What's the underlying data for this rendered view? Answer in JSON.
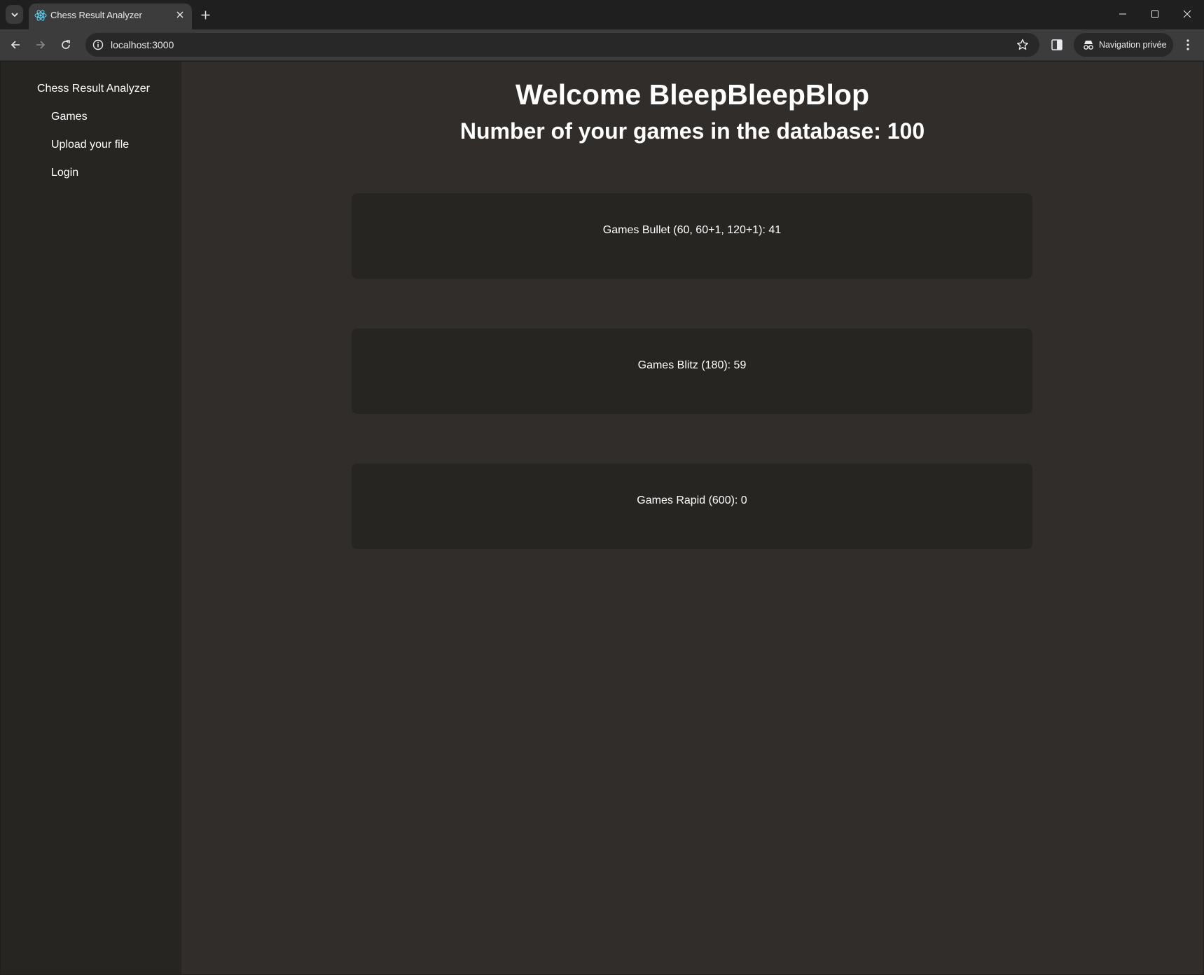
{
  "browser": {
    "tab_title": "Chess Result Analyzer",
    "url": "localhost:3000",
    "incognito_label": "Navigation privée"
  },
  "sidebar": {
    "brand": "Chess Result Analyzer",
    "items": [
      {
        "label": "Games"
      },
      {
        "label": "Upload your file"
      },
      {
        "label": "Login"
      }
    ]
  },
  "main": {
    "welcome": "Welcome BleepBleepBlop",
    "game_count": "Number of your games in the database: 100",
    "cards": [
      {
        "label": "Games Bullet (60, 60+1, 120+1): 41"
      },
      {
        "label": "Games Blitz (180): 59"
      },
      {
        "label": "Games Rapid (600): 0"
      }
    ]
  },
  "colors": {
    "page_bg": "#312d2a",
    "sidebar_bg": "#262522",
    "card_bg": "#272522",
    "text": "#ffffff",
    "react_favicon": "#61dafb"
  },
  "icons": [
    "tab-search-icon",
    "react-favicon-icon",
    "close-icon",
    "plus-icon",
    "minimize-icon",
    "maximize-icon",
    "window-close-icon",
    "back-arrow-icon",
    "forward-arrow-icon",
    "reload-icon",
    "info-icon",
    "star-icon",
    "side-panel-icon",
    "incognito-icon",
    "kebab-menu-icon"
  ]
}
